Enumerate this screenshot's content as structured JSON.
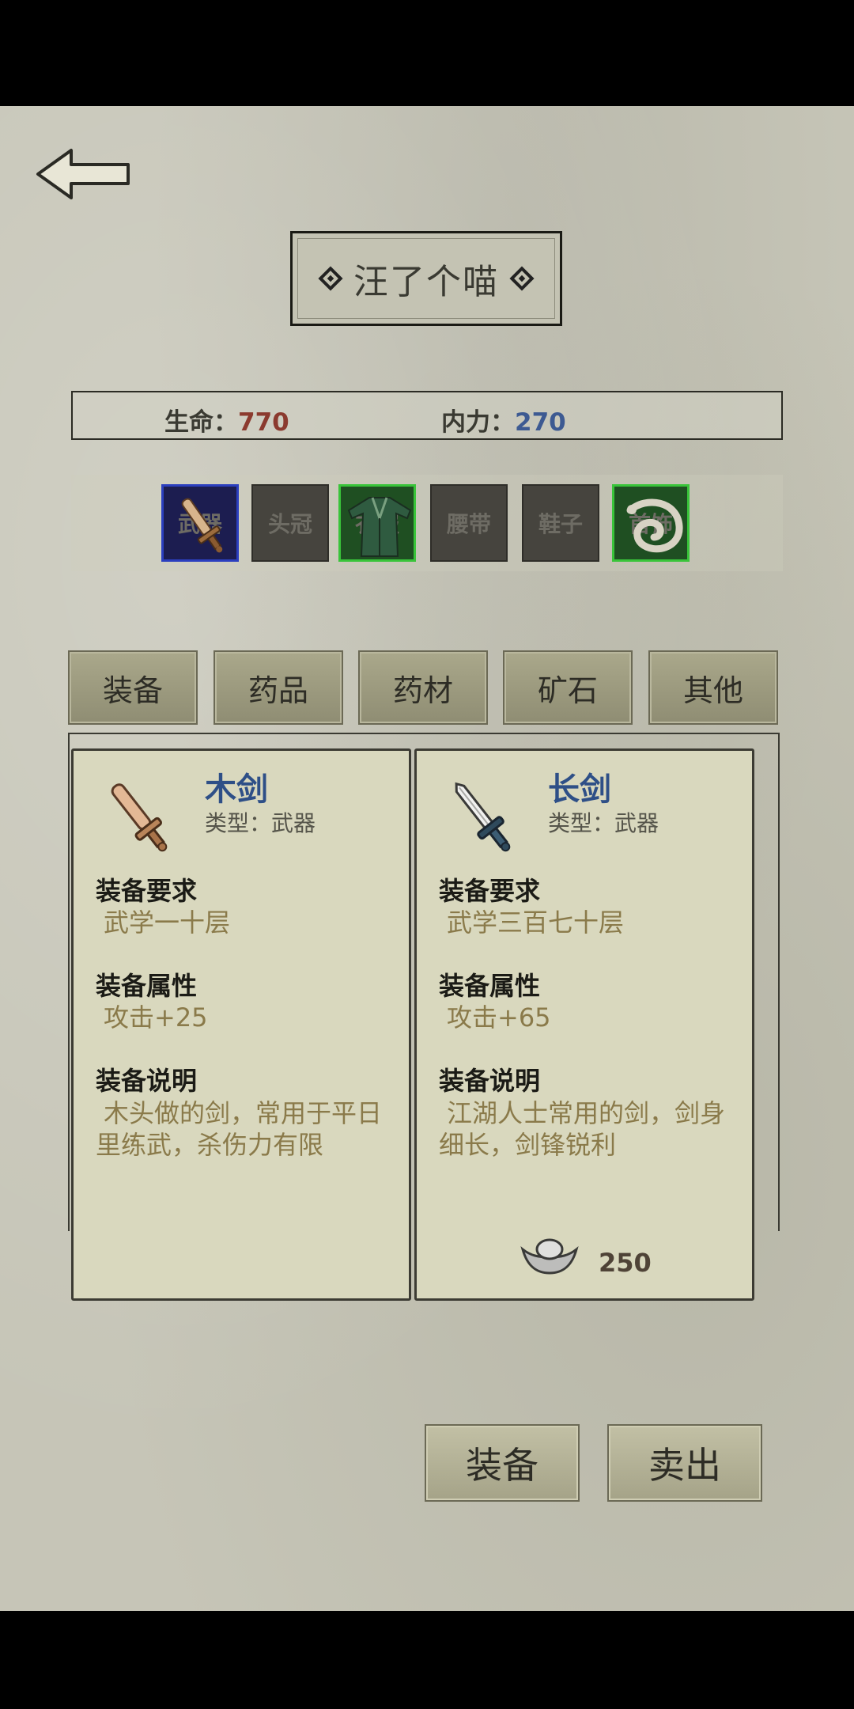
{
  "character": {
    "name": "汪了个喵"
  },
  "stats": {
    "hp_label": "生命：",
    "hp_value": "770",
    "mp_label": "内力：",
    "mp_value": "270"
  },
  "equipment_slots": [
    {
      "label": "武器",
      "icon": "sword-icon",
      "state": "equipped-selected"
    },
    {
      "label": "头冠",
      "icon": null,
      "state": "empty"
    },
    {
      "label": "衣服",
      "icon": "robe-icon",
      "state": "equipped"
    },
    {
      "label": "腰带",
      "icon": null,
      "state": "empty"
    },
    {
      "label": "鞋子",
      "icon": null,
      "state": "empty"
    },
    {
      "label": "首饰",
      "icon": "dragon-ring-icon",
      "state": "equipped"
    }
  ],
  "tabs": [
    "装备",
    "药品",
    "药材",
    "矿石",
    "其他"
  ],
  "items": [
    {
      "name": "木剑",
      "type": "类型：武器",
      "icon": "wooden-sword-icon",
      "req_title": "装备要求",
      "req": "武学一十层",
      "attr_title": "装备属性",
      "attr": "攻击+25",
      "desc_title": "装备说明",
      "desc": "木头做的剑，常用于平日里练武，杀伤力有限"
    },
    {
      "name": "长剑",
      "type": "类型：武器",
      "icon": "long-sword-icon",
      "req_title": "装备要求",
      "req": "武学三百七十层",
      "attr_title": "装备属性",
      "attr": "攻击+65",
      "desc_title": "装备说明",
      "desc": "江湖人士常用的剑，剑身细长，剑锋锐利",
      "price": "250",
      "price_icon": "silver-ingot-icon"
    }
  ],
  "actions": {
    "equip": "装备",
    "sell": "卖出"
  },
  "colors": {
    "background": "#c6c5b7",
    "hp": "#8b3a2e",
    "mp": "#3d5a92",
    "item_name": "#2e4f87",
    "item_value": "#8a7a4a",
    "slot_selected_border": "#2b3fbf",
    "slot_equipped_border": "#39c43a"
  }
}
